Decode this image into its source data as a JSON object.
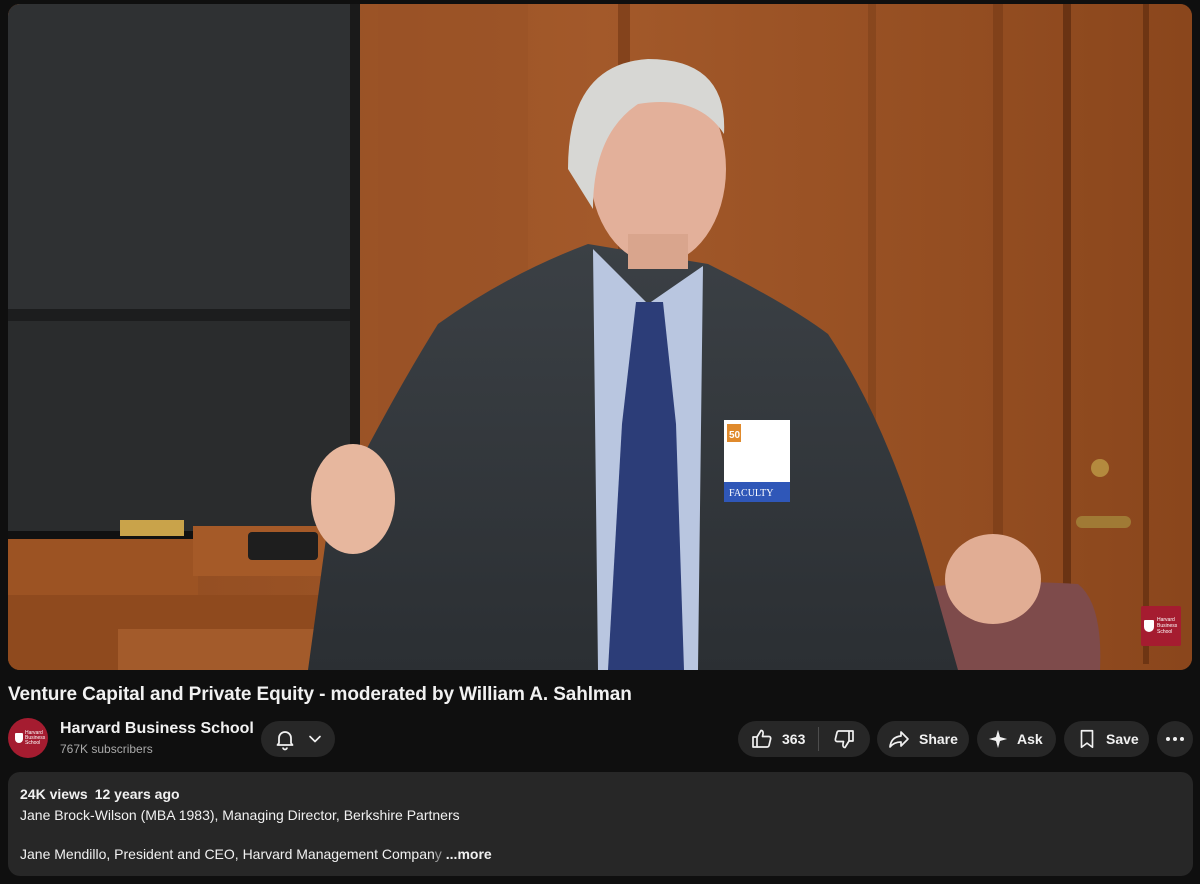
{
  "video": {
    "badge_number": "50",
    "badge_label": "FACULTY",
    "watermark_text": "Harvard Business School",
    "watermark_icon": "shield-icon"
  },
  "title": "Venture Capital and Private Equity - moderated by William A. Sahlman",
  "channel": {
    "name": "Harvard Business School",
    "subscribers": "767K subscribers",
    "avatar_text": "Harvard Business School",
    "avatar_color": "#a51c30"
  },
  "actions": {
    "notifications_icon": "bell-icon",
    "dropdown_icon": "chevron-down-icon",
    "like_count": "363",
    "like_icon": "thumbs-up-icon",
    "dislike_icon": "thumbs-down-icon",
    "share_label": "Share",
    "ask_label": "Ask",
    "save_label": "Save",
    "more_icon": "more-horizontal-icon"
  },
  "description": {
    "views": "24K views",
    "age": "12 years ago",
    "line1": "Jane Brock-Wilson (MBA 1983), Managing Director, Berkshire Partners",
    "line2": "Jane Mendillo, President and CEO, Harvard Management Compan",
    "line2_fade": "y",
    "more_label": "...more"
  },
  "colors": {
    "background": "#0f0f0f",
    "surface": "#272727",
    "text_primary": "#f1f1f1",
    "text_secondary": "#aaaaaa",
    "brand": "#a51c30"
  }
}
